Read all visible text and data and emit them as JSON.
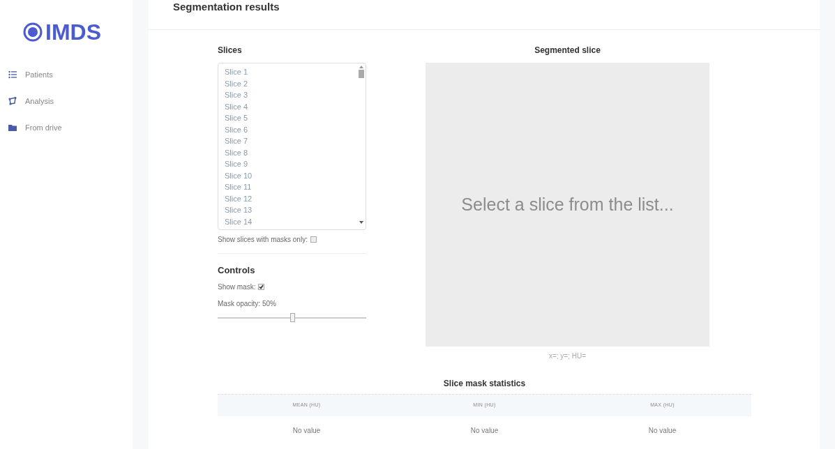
{
  "logo": {
    "text": "IMDS"
  },
  "sidebar": {
    "items": [
      {
        "label": "Patients",
        "kind": "list"
      },
      {
        "label": "Analysis",
        "kind": "analysis"
      },
      {
        "label": "From drive",
        "kind": "folder"
      }
    ]
  },
  "header": {
    "title": "Segmentation results"
  },
  "slices": {
    "title": "Slices",
    "items": [
      "Slice 1",
      "Slice 2",
      "Slice 3",
      "Slice 4",
      "Slice 5",
      "Slice 6",
      "Slice 7",
      "Slice 8",
      "Slice 9",
      "Slice 10",
      "Slice 11",
      "Slice 12",
      "Slice 13",
      "Slice 14"
    ],
    "masks_only": {
      "label": "Show slices with masks only:",
      "checked": false
    }
  },
  "controls": {
    "title": "Controls",
    "show_mask": {
      "label": "Show mask:",
      "checked": true
    },
    "opacity": {
      "label": "Mask opacity: 50%",
      "level": 0.5
    }
  },
  "viewer": {
    "title": "Segmented slice",
    "prompt": "Select a slice from the list...",
    "coords": "x=; y=; HU="
  },
  "stats": {
    "title": "Slice mask statistics",
    "columns": [
      "MEAN (HU)",
      "MIN (HU)",
      "MAX (HU)"
    ],
    "rows": [
      [
        "No value",
        "No value",
        "No value"
      ]
    ]
  }
}
